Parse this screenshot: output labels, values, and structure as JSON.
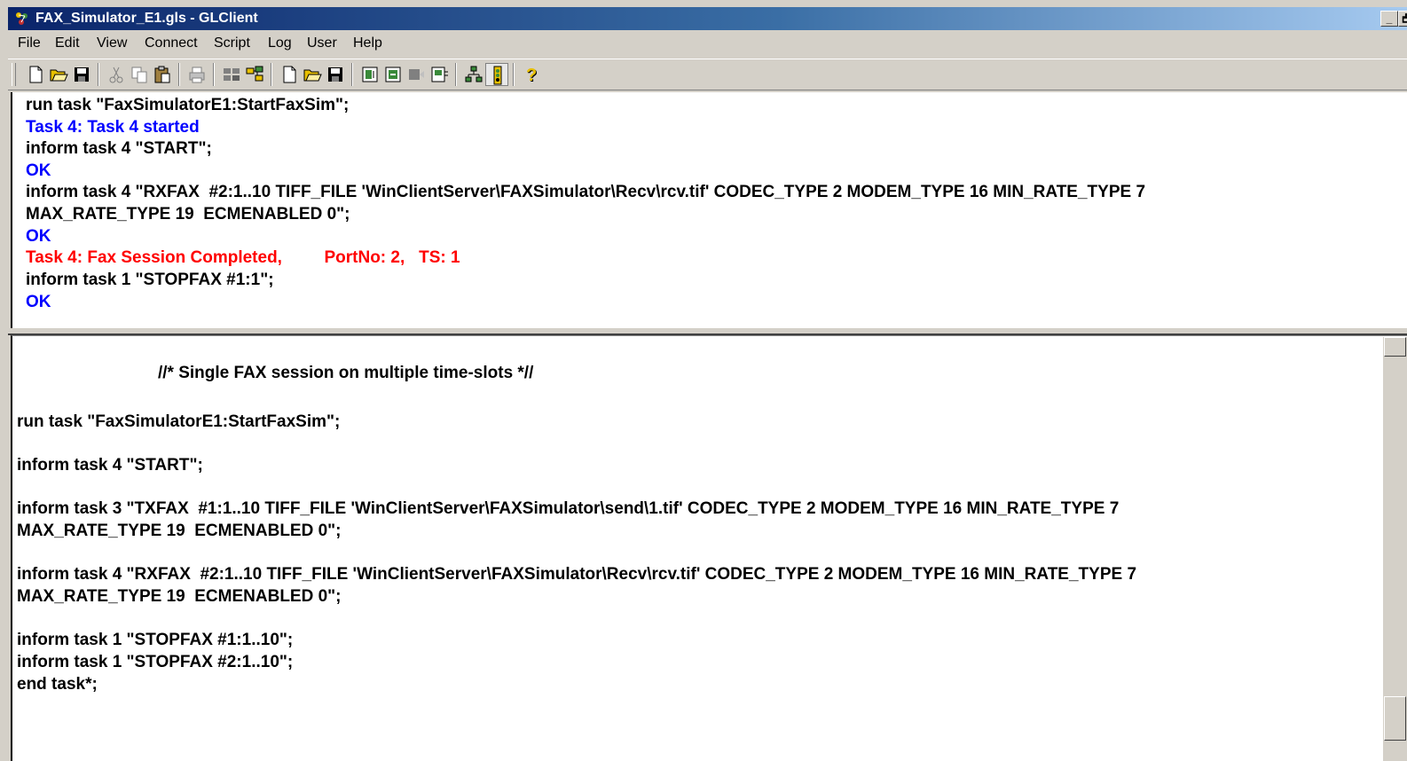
{
  "window": {
    "title": "FAX_Simulator_E1.gls - GLClient",
    "icon": "glclient-app-icon",
    "controls": {
      "minimize": "_",
      "restore": "🗗"
    }
  },
  "menu": [
    "File",
    "Edit",
    "View",
    "Connect",
    "Script",
    "Log",
    "User",
    "Help"
  ],
  "toolbar": {
    "icons": [
      "new-icon",
      "open-icon",
      "save-icon",
      "cut-icon",
      "copy-icon",
      "paste-icon",
      "print-icon",
      "connect-icon",
      "disconnect-icon",
      "new-script-icon",
      "open-script-icon",
      "save-script-icon",
      "run-icon",
      "stop-icon",
      "step-icon",
      "debug-icon",
      "network-icon",
      "traffic-light-icon",
      "help-icon"
    ]
  },
  "output": {
    "lines": [
      {
        "text": "run task \"FaxSimulatorE1:StartFaxSim\";",
        "color": "black"
      },
      {
        "text": "Task 4: Task 4 started",
        "color": "blue"
      },
      {
        "text": "inform task 4 \"START\";",
        "color": "black"
      },
      {
        "text": "OK",
        "color": "blue"
      },
      {
        "text": "inform task 4 \"RXFAX  #2:1..10 TIFF_FILE 'WinClientServer\\FAXSimulator\\Recv\\rcv.tif' CODEC_TYPE 2 MODEM_TYPE 16 MIN_RATE_TYPE 7",
        "color": "black"
      },
      {
        "text": "MAX_RATE_TYPE 19  ECMENABLED 0\";",
        "color": "black"
      },
      {
        "text": "OK",
        "color": "blue"
      },
      {
        "text": "Task 4: Fax Session Completed,         PortNo: 2,   TS: 1",
        "color": "red"
      },
      {
        "text": "inform task 1 \"STOPFAX #1:1\";",
        "color": "black"
      },
      {
        "text": "OK",
        "color": "blue"
      }
    ]
  },
  "script": {
    "comment": "//* Single FAX session on multiple time-slots *//",
    "lines": [
      "run task \"FaxSimulatorE1:StartFaxSim\";",
      "inform task 4 \"START\";",
      "inform task 3 \"TXFAX  #1:1..10 TIFF_FILE 'WinClientServer\\FAXSimulator\\send\\1.tif' CODEC_TYPE 2 MODEM_TYPE 16 MIN_RATE_TYPE 7",
      "MAX_RATE_TYPE 19  ECMENABLED 0\";",
      "inform task 4 \"RXFAX  #2:1..10 TIFF_FILE 'WinClientServer\\FAXSimulator\\Recv\\rcv.tif' CODEC_TYPE 2 MODEM_TYPE 16 MIN_RATE_TYPE 7",
      "MAX_RATE_TYPE 19  ECMENABLED 0\";",
      "inform task 1 \"STOPFAX #1:1..10\";",
      "inform task 1 \"STOPFAX #2:1..10\";",
      "end task*;"
    ]
  },
  "colors": {
    "black": "#000000",
    "blue": "#0000ff",
    "red": "#ff0000",
    "titlebar": "#0a246a",
    "chrome": "#d4d0c8"
  }
}
